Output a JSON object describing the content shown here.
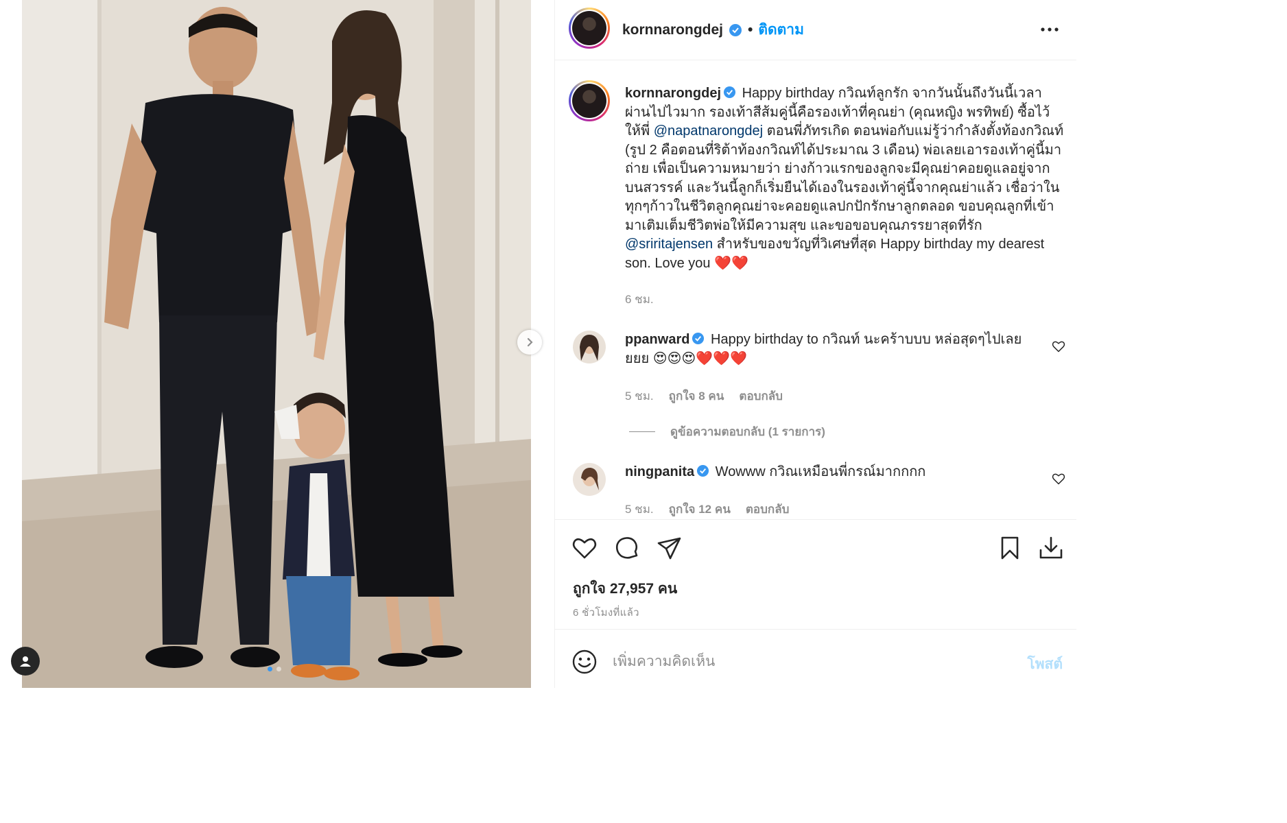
{
  "header": {
    "username": "kornnarongdej",
    "separator": "•",
    "follow_label": "ติดตาม"
  },
  "caption": {
    "username": "kornnarongdej",
    "text_1": "Happy birthday กวิณท์ลูกรัก จากวันนั้นถึงวันนี้เวลาผ่านไปไวมาก รองเท้าสีส้มคู่นี้คือรองเท้าที่คุณย่า (คุณหญิง พรทิพย์) ซื้อไว้ให้พี่ ",
    "mention_1": "@napatnarongdej",
    "text_2": " ตอนพี่ภัทรเกิด ตอนพ่อกับแม่รู้ว่ากำลังตั้งท้องกวิณท์ (รูป 2 คือตอนที่ริต้าท้องกวิณท์ได้ประมาณ 3 เดือน) พ่อเลยเอารองเท้าคู่นี้มาถ่าย เพื่อเป็นความหมายว่า ย่างก้าวแรกของลูกจะมีคุณย่าคอยดูแลอยู่จากบนสวรรค์ และวันนี้ลูกก็เริ่มยืนได้เองในรองเท้าคู่นี้จากคุณย่าแล้ว เชื่อว่าในทุกๆก้าวในชีวิตลูกคุณย่าจะคอยดูแลปกปักรักษาลูกตลอด ขอบคุณลูกที่เข้ามาเติมเต็มชีวิตพ่อให้มีความสุข และขอขอบคุณภรรยาสุดที่รัก ",
    "mention_2": "@sriritajensen",
    "text_3": " สำหรับของขวัญที่วิเศษที่สุด Happy birthday my dearest son. Love you ❤️❤️",
    "time": "6 ชม."
  },
  "comments": [
    {
      "username": "ppanward",
      "text": "Happy birthday to กวิณท์ นะคร้าบบบ หล่อสุดๆไปเลยยยย 😍😍😍❤️❤️❤️",
      "time": "5 ชม.",
      "likes": "ถูกใจ 8 คน",
      "reply_label": "ตอบกลับ",
      "view_replies": "ดูข้อความตอบกลับ (1 รายการ)"
    },
    {
      "username": "ningpanita",
      "text": "Wowww กวิณเหมือนพี่กรณ์มากกกก",
      "time": "5 ชม.",
      "likes": "ถูกใจ 12 คน",
      "reply_label": "ตอบกลับ"
    }
  ],
  "stats": {
    "likes": "ถูกใจ 27,957 คน",
    "time_ago": "6 ชั่วโมงที่แล้ว"
  },
  "add_comment": {
    "placeholder": "เพิ่มความคิดเห็น",
    "post_label": "โพสต์"
  },
  "carousel": {
    "total": 2,
    "current": 1
  },
  "colors": {
    "accent": "#0095f6",
    "verified": "#3897f0",
    "muted": "#8e8e8e",
    "mention": "#00376b",
    "text": "#262626"
  },
  "icons": [
    "tag-user-icon",
    "chevron-right-icon",
    "verified-badge-icon",
    "more-options-icon",
    "heart-icon",
    "comment-icon",
    "share-icon",
    "bookmark-icon",
    "download-icon",
    "emoji-icon"
  ]
}
